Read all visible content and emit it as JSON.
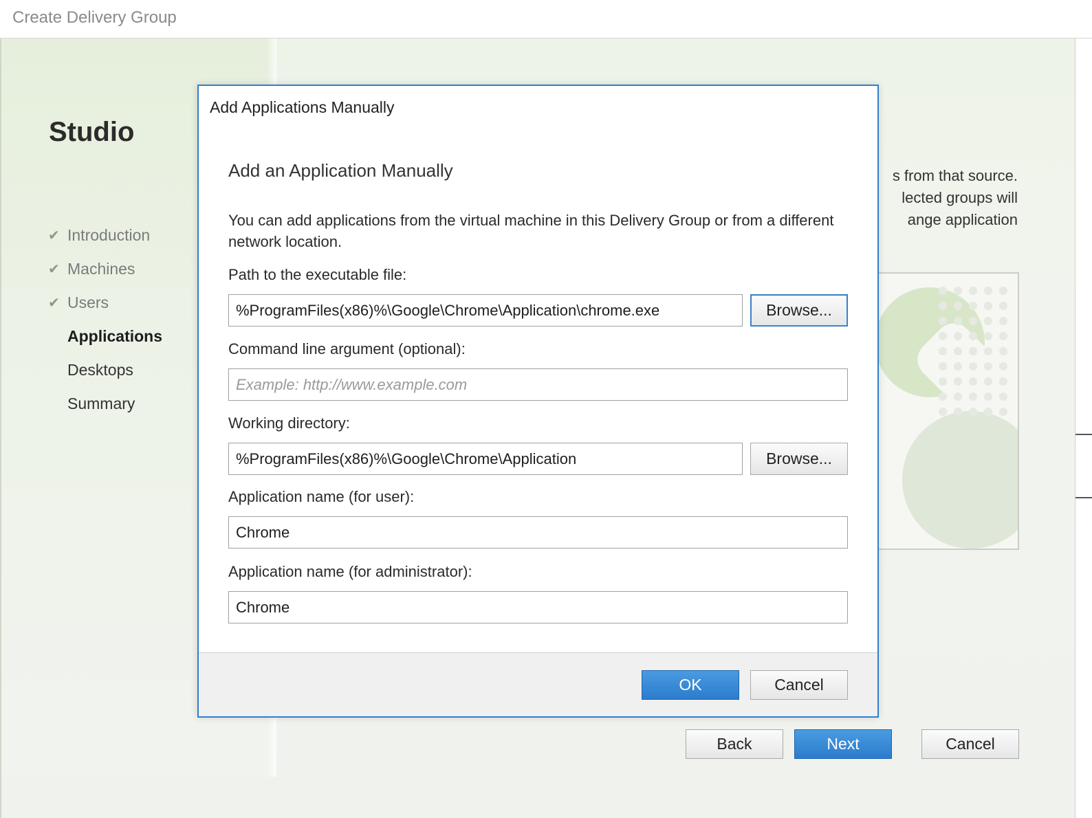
{
  "window": {
    "title": "Create Delivery Group"
  },
  "sidebar": {
    "brand": "Studio",
    "steps": [
      {
        "label": "Introduction",
        "state": "done"
      },
      {
        "label": "Machines",
        "state": "done"
      },
      {
        "label": "Users",
        "state": "done"
      },
      {
        "label": "Applications",
        "state": "active"
      },
      {
        "label": "Desktops",
        "state": "pending"
      },
      {
        "label": "Summary",
        "state": "pending"
      }
    ]
  },
  "background_text": {
    "line1": "s from that source.",
    "line2": "lected groups will",
    "line3": "ange application"
  },
  "wizard_buttons": {
    "back": "Back",
    "next": "Next",
    "cancel": "Cancel"
  },
  "dialog": {
    "title": "Add Applications Manually",
    "heading": "Add an Application Manually",
    "description": "You can add applications from the virtual machine in this Delivery Group or from a different network location.",
    "path": {
      "label": "Path to the executable file:",
      "value": "%ProgramFiles(x86)%\\Google\\Chrome\\Application\\chrome.exe",
      "browse_label": "Browse..."
    },
    "args": {
      "label": "Command line argument (optional):",
      "placeholder": "Example: http://www.example.com",
      "value": ""
    },
    "workdir": {
      "label": "Working directory:",
      "value": "%ProgramFiles(x86)%\\Google\\Chrome\\Application",
      "browse_label": "Browse..."
    },
    "user_name": {
      "label": "Application name (for user):",
      "value": "Chrome"
    },
    "admin_name": {
      "label": "Application name (for administrator):",
      "value": "Chrome"
    },
    "ok_label": "OK",
    "cancel_label": "Cancel"
  },
  "colors": {
    "accent": "#2f7fcf",
    "primary_button": "#2b7ccd",
    "check": "#8d9a82"
  },
  "icons": {
    "completed_step": "checkmark-icon"
  }
}
